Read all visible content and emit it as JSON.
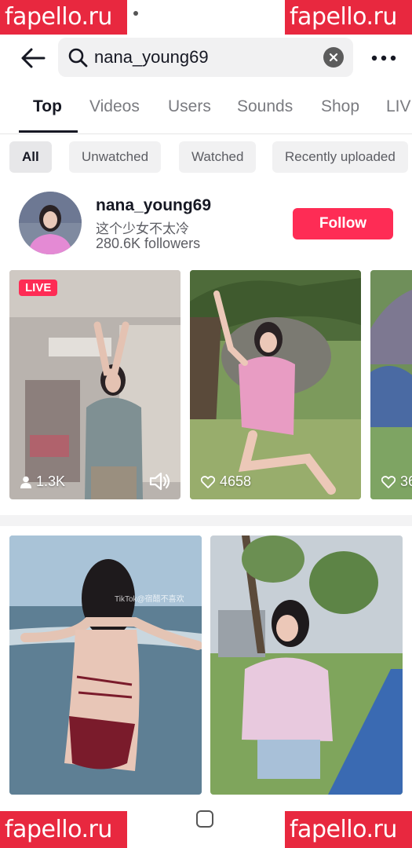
{
  "watermarks": [
    "fapello.ru",
    "fapello.ru",
    "fapello.ru",
    "fapello.ru"
  ],
  "search": {
    "query": "nana_young69"
  },
  "tabs": [
    {
      "label": "Top",
      "active": true
    },
    {
      "label": "Videos",
      "active": false
    },
    {
      "label": "Users",
      "active": false
    },
    {
      "label": "Sounds",
      "active": false
    },
    {
      "label": "Shop",
      "active": false
    },
    {
      "label": "LIV",
      "active": false
    }
  ],
  "filters": [
    {
      "label": "All",
      "active": true
    },
    {
      "label": "Unwatched",
      "active": false
    },
    {
      "label": "Watched",
      "active": false
    },
    {
      "label": "Recently uploaded",
      "active": false
    }
  ],
  "profile": {
    "username": "nana_young69",
    "bio": "这个少女不太冷",
    "followers": "280.6K followers",
    "follow_label": "Follow"
  },
  "videos": [
    {
      "badge": "LIVE",
      "viewers": "1.3K",
      "icon": "person-icon"
    },
    {
      "likes": "4658",
      "icon": "heart-icon"
    },
    {
      "likes": "36",
      "icon": "heart-icon"
    }
  ],
  "grid_watermark": "TikTok@宿醋不喜欢",
  "colors": {
    "accent": "#fe2c55",
    "watermark": "#e8283f",
    "text": "#161823",
    "muted": "#7a7b80"
  }
}
